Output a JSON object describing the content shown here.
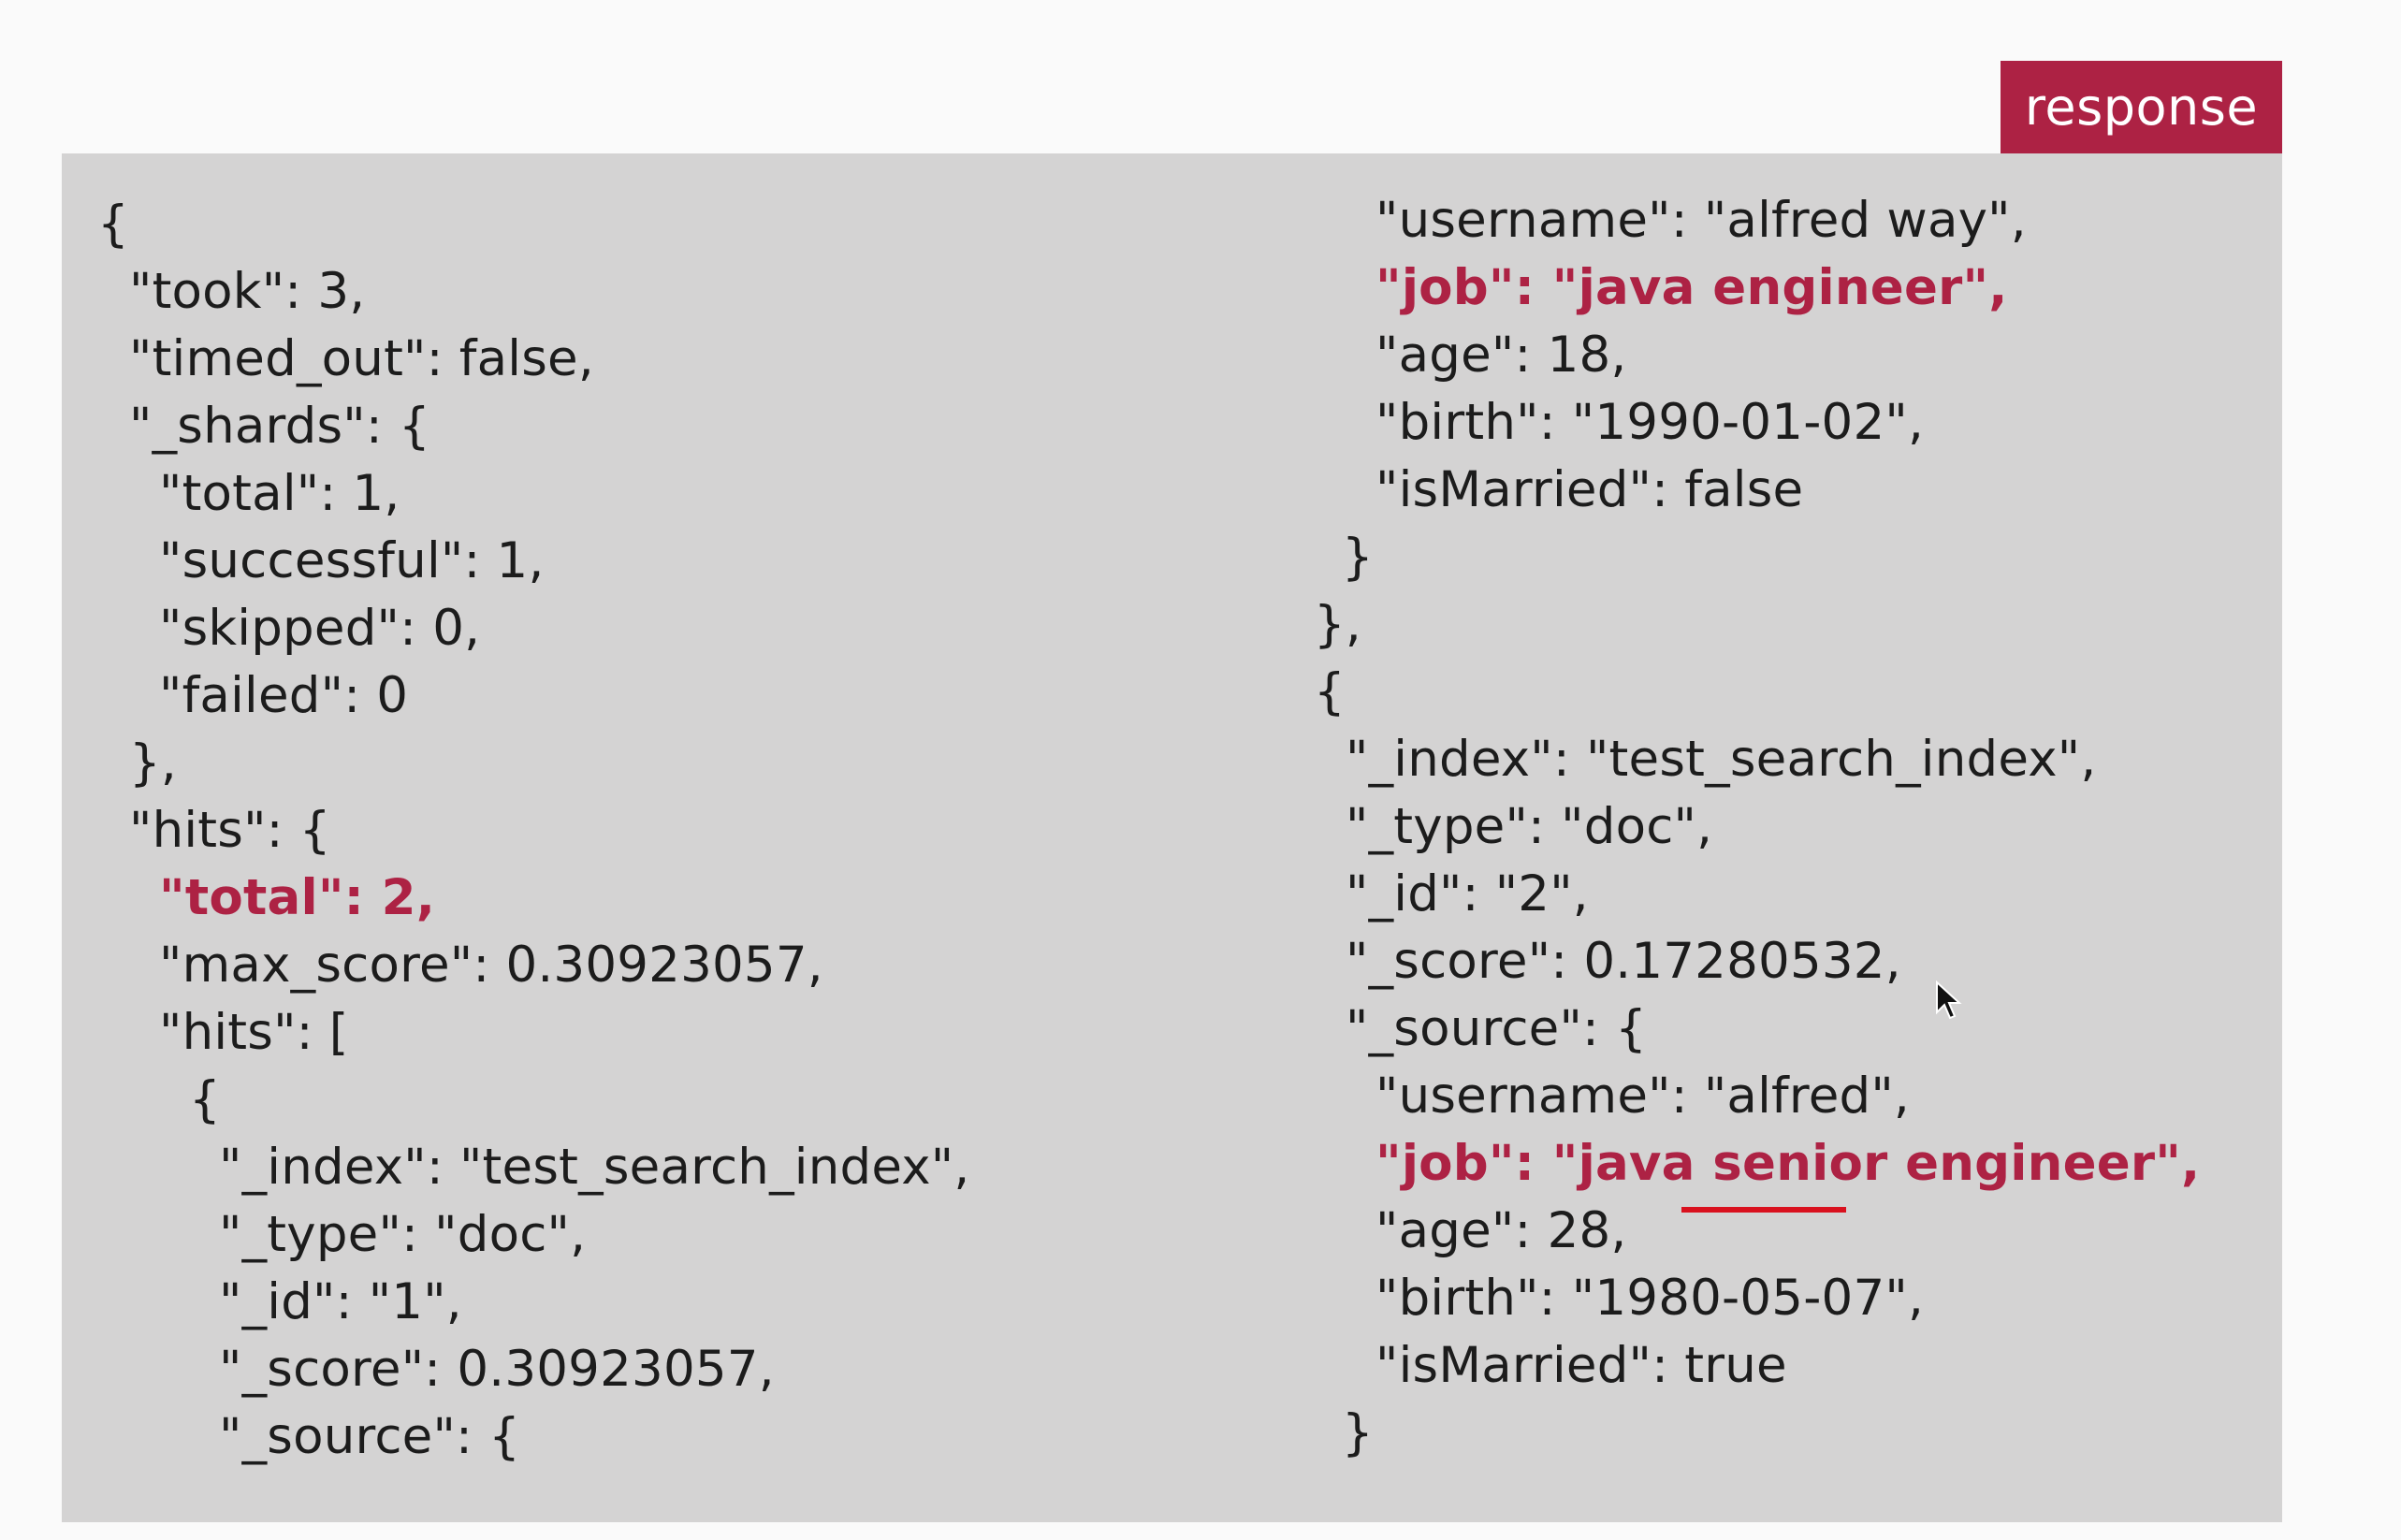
{
  "badge": {
    "label": "response"
  },
  "colors": {
    "accent": "#ad2244",
    "panel": "#d4d3d3",
    "underline": "#d9111e"
  },
  "left_column": [
    {
      "text": "{",
      "highlight": false
    },
    {
      "text": "\"took\": 3,",
      "highlight": false
    },
    {
      "text": "\"timed_out\": false,",
      "highlight": false
    },
    {
      "text": "\"_shards\": {",
      "highlight": false
    },
    {
      "text": "\"total\": 1,",
      "highlight": false
    },
    {
      "text": "\"successful\": 1,",
      "highlight": false
    },
    {
      "text": "\"skipped\": 0,",
      "highlight": false
    },
    {
      "text": "\"failed\": 0",
      "highlight": false
    },
    {
      "text": "},",
      "highlight": false
    },
    {
      "text": "\"hits\": {",
      "highlight": false
    },
    {
      "text": "\"total\": 2,",
      "highlight": true
    },
    {
      "text": "\"max_score\": 0.30923057,",
      "highlight": false
    },
    {
      "text": "\"hits\": [",
      "highlight": false
    },
    {
      "text": "{",
      "highlight": false
    },
    {
      "text": "\"_index\": \"test_search_index\",",
      "highlight": false
    },
    {
      "text": "\"_type\": \"doc\",",
      "highlight": false
    },
    {
      "text": "\"_id\": \"1\",",
      "highlight": false
    },
    {
      "text": "\"_score\": 0.30923057,",
      "highlight": false
    },
    {
      "text": "\"_source\": {",
      "highlight": false
    }
  ],
  "right_column": [
    {
      "text": "\"username\": \"alfred way\",",
      "highlight": false
    },
    {
      "text": "\"job\": \"java engineer\",",
      "highlight": true
    },
    {
      "text": "\"age\": 18,",
      "highlight": false
    },
    {
      "text": "\"birth\": \"1990-01-02\",",
      "highlight": false
    },
    {
      "text": "\"isMarried\": false",
      "highlight": false
    },
    {
      "text": "}",
      "highlight": false
    },
    {
      "text": "},",
      "highlight": false
    },
    {
      "text": "{",
      "highlight": false
    },
    {
      "text": "\"_index\": \"test_search_index\",",
      "highlight": false
    },
    {
      "text": "\"_type\": \"doc\",",
      "highlight": false
    },
    {
      "text": "\"_id\": \"2\",",
      "highlight": false
    },
    {
      "text": "\"_score\": 0.17280532,",
      "highlight": false
    },
    {
      "text": "\"_source\": {",
      "highlight": false
    },
    {
      "text": "\"username\": \"alfred\",",
      "highlight": false
    },
    {
      "text": "\"job\": \"java senior engineer\",",
      "highlight": true
    },
    {
      "text": "\"age\": 28,",
      "highlight": false
    },
    {
      "text": "\"birth\": \"1980-05-07\",",
      "highlight": false
    },
    {
      "text": "\"isMarried\": true",
      "highlight": false
    },
    {
      "text": "}",
      "highlight": false
    }
  ],
  "underlined_word": "senior",
  "icons": {
    "cursor": "mouse-pointer-icon"
  }
}
